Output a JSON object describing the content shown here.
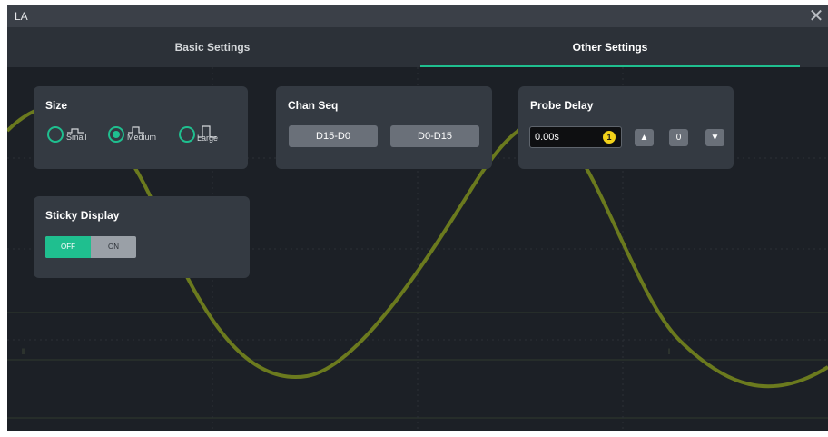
{
  "window": {
    "title": "LA"
  },
  "tabs": [
    {
      "label": "Basic Settings",
      "active": false
    },
    {
      "label": "Other Settings",
      "active": true
    }
  ],
  "size": {
    "title": "Size",
    "options": [
      {
        "label": "Small",
        "checked": false
      },
      {
        "label": "Medium",
        "checked": true
      },
      {
        "label": "Large",
        "checked": false
      }
    ]
  },
  "chan_seq": {
    "title": "Chan Seq",
    "buttons": [
      "D15-D0",
      "D0-D15"
    ]
  },
  "probe_delay": {
    "title": "Probe Delay",
    "value": "0.00s",
    "knob_badge": "1",
    "step_value": "0",
    "icons": [
      "knob-icon",
      "arrow-up-icon",
      "arrow-down-icon"
    ]
  },
  "sticky_display": {
    "title": "Sticky Display",
    "off_label": "OFF",
    "on_label": "ON",
    "state": "OFF"
  },
  "colors": {
    "accent": "#1fbf8f",
    "background": "#1c2026",
    "panel": "#343a42",
    "waveform": "#6b7a1e"
  }
}
